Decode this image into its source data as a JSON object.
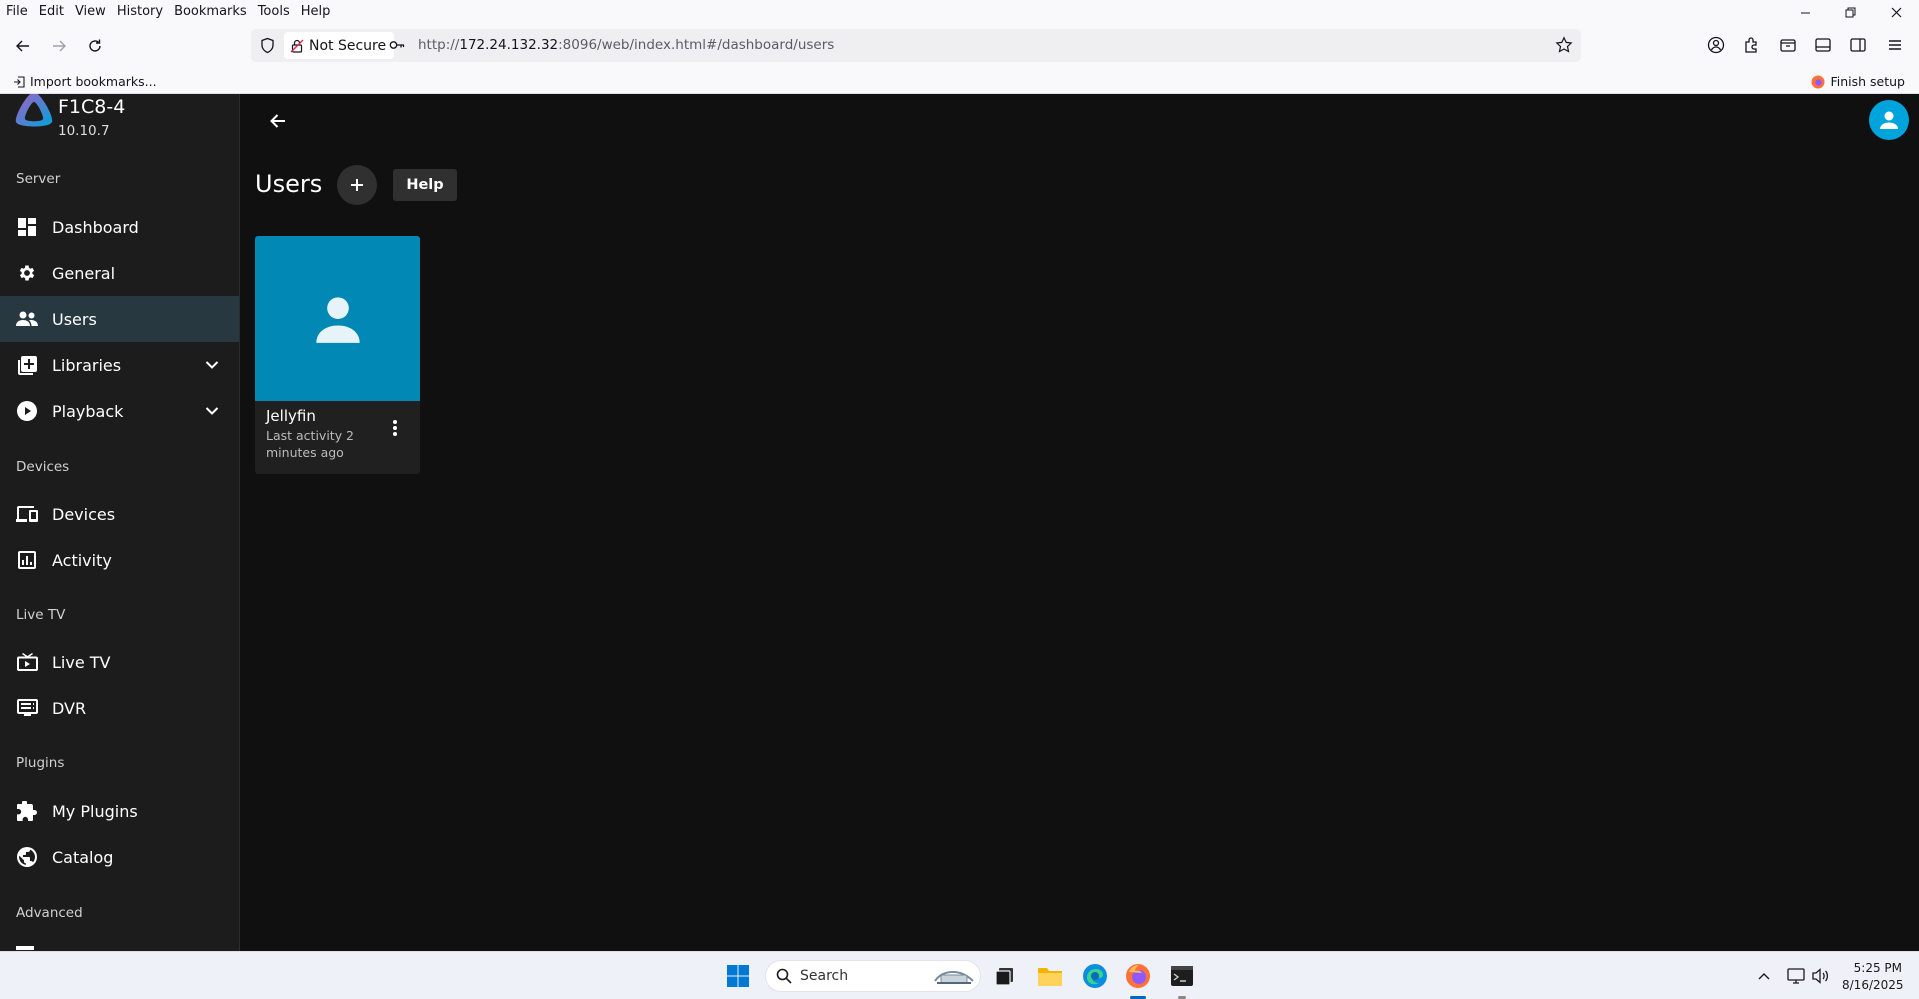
{
  "browser": {
    "menu": [
      "File",
      "Edit",
      "View",
      "History",
      "Bookmarks",
      "Tools",
      "Help"
    ],
    "url_security_label": "Not Secure",
    "url_prefix": "http://",
    "url_host": "172.24.132.32",
    "url_rest": ":8096/web/index.html#/dashboard/users",
    "bookmarks_import": "Import bookmarks...",
    "finish_setup": "Finish setup"
  },
  "server": {
    "name": "F1C8-4",
    "version": "10.10.7"
  },
  "sidebar": {
    "sections": [
      {
        "header": "Server",
        "items": [
          {
            "label": "Dashboard",
            "icon": "dashboard-icon"
          },
          {
            "label": "General",
            "icon": "gear-icon"
          },
          {
            "label": "Users",
            "icon": "people-icon",
            "active": true
          },
          {
            "label": "Libraries",
            "icon": "library-add-icon",
            "expandable": true
          },
          {
            "label": "Playback",
            "icon": "play-circle-icon",
            "expandable": true
          }
        ]
      },
      {
        "header": "Devices",
        "items": [
          {
            "label": "Devices",
            "icon": "devices-icon"
          },
          {
            "label": "Activity",
            "icon": "analytics-icon"
          }
        ]
      },
      {
        "header": "Live TV",
        "items": [
          {
            "label": "Live TV",
            "icon": "live-tv-icon"
          },
          {
            "label": "DVR",
            "icon": "dvr-icon"
          }
        ]
      },
      {
        "header": "Plugins",
        "items": [
          {
            "label": "My Plugins",
            "icon": "puzzle-icon"
          },
          {
            "label": "Catalog",
            "icon": "globe-icon"
          }
        ]
      },
      {
        "header": "Advanced",
        "items": []
      }
    ]
  },
  "main": {
    "title": "Users",
    "help_label": "Help",
    "users": [
      {
        "name": "Jellyfin",
        "activity": "Last activity 2 minutes ago"
      }
    ]
  },
  "taskbar": {
    "search_label": "Search",
    "time": "5:25 PM",
    "date": "8/16/2025"
  },
  "colors": {
    "accent": "#00a4dc",
    "card_image": "#0288b5",
    "sidebar_active": "#273840",
    "background": "#101010",
    "sidebar_bg": "#1c1c1c"
  }
}
